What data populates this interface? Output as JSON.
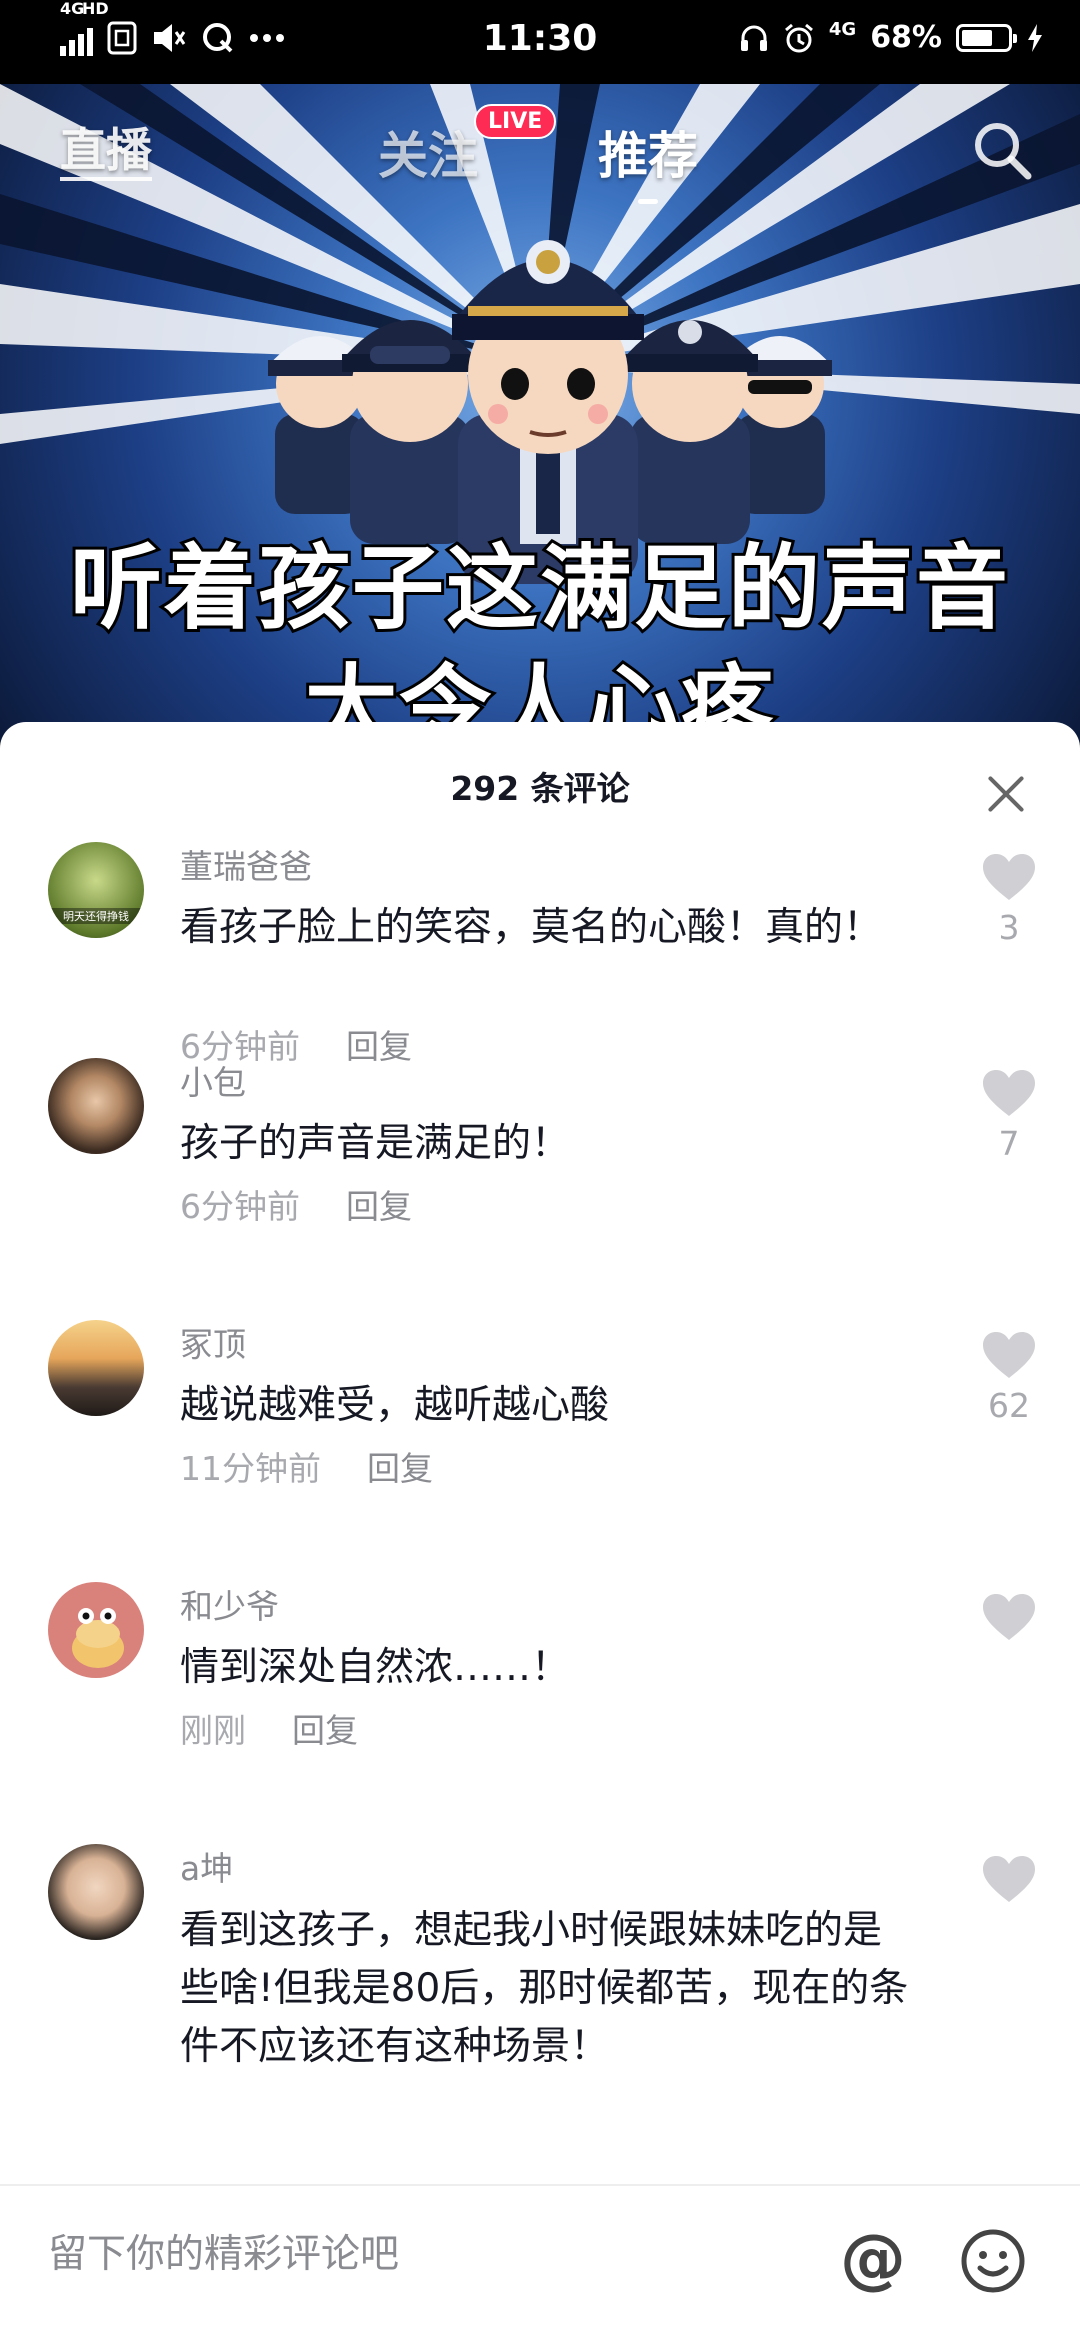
{
  "status_bar": {
    "network_left": "4G",
    "network_left_tag": "HD",
    "time": "11:30",
    "network_right": "4G",
    "battery": "68%",
    "battery_level": 0.68,
    "icons": [
      "signal-icon",
      "sim-icon",
      "mute-icon",
      "q-app-icon",
      "more-dots-icon",
      "headphones-icon",
      "alarm-icon",
      "battery-icon",
      "charging-icon"
    ]
  },
  "top_nav": {
    "live_entry": "直播",
    "tab_follow": "关注",
    "live_badge": "LIVE",
    "tab_recommend": "推荐"
  },
  "video": {
    "caption_line1": "听着孩子这满足的声音",
    "caption_line2": "太令人心疼"
  },
  "comments_panel": {
    "title": "292 条评论",
    "comments": [
      {
        "user": "董瑞爸爸",
        "avatar_text": "明天还得挣钱",
        "text": "看孩子脸上的笑容，莫名的心酸！真的！",
        "time": "6分钟前",
        "reply": "回复",
        "likes": "3"
      },
      {
        "user": "小包",
        "text": "孩子的声音是满足的！",
        "time": "6分钟前",
        "reply": "回复",
        "likes": "7"
      },
      {
        "user": "冢顶",
        "text": "越说越难受，越听越心酸",
        "time": "11分钟前",
        "reply": "回复",
        "likes": "62"
      },
      {
        "user": "和少爷",
        "text": "情到深处自然浓……！",
        "time": "刚刚",
        "reply": "回复",
        "likes": ""
      },
      {
        "user": "a坤",
        "text": "看到这孩子，想起我小时候跟妹妹吃的是些啥!但我是80后，那时候都苦，现在的条件不应该还有这种场景！",
        "likes": ""
      }
    ]
  },
  "input_bar": {
    "placeholder": "留下你的精彩评论吧",
    "at_symbol": "@"
  },
  "colors": {
    "accent_live": "#fe2c55",
    "text_primary": "#161823",
    "text_secondary": "#8a8b91",
    "like_icon": "#d0d0d4"
  }
}
